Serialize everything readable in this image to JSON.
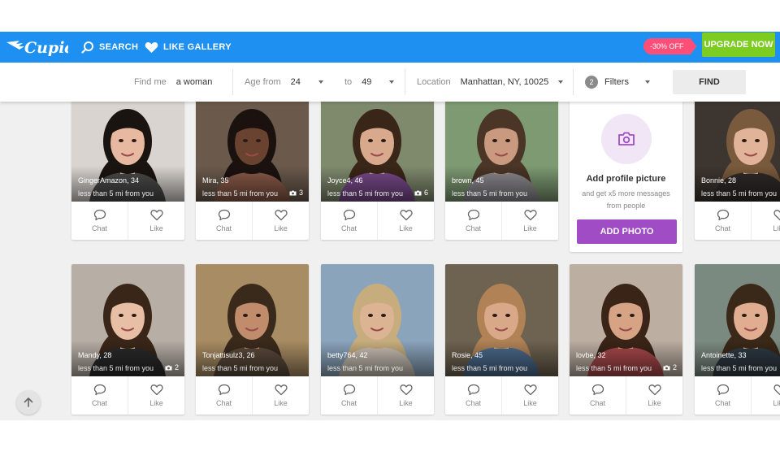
{
  "nav": {
    "logo_text": "Cupid",
    "search_label": "SEARCH",
    "gallery_label": "LIKE GALLERY",
    "discount_label": "-30% OFF",
    "upgrade_label": "UPGRADE NOW",
    "colors": {
      "bar": "#1e90f2",
      "upgrade": "#7ccc21",
      "discount": "#ff4f78"
    }
  },
  "filters": {
    "find_me_label": "Find me",
    "find_me_value": "a woman",
    "age_from_label": "Age from",
    "age_from_value": "24",
    "age_to_label": "to",
    "age_to_value": "49",
    "location_label": "Location",
    "location_value": "Manhattan, NY, 10025",
    "filters_count": "2",
    "filters_label": "Filters",
    "find_label": "FIND"
  },
  "add_photo": {
    "title": "Add profile picture",
    "subtitle": "and get x5 more messages from people",
    "button_label": "ADD PHOTO",
    "accent": "#a04cc4"
  },
  "actions": {
    "chat_label": "Chat",
    "like_label": "Like"
  },
  "profiles": [
    {
      "name": "GingerAmazon, 34",
      "distance": "less than 5 mi from you",
      "photos": "",
      "bg": "#d9d4cf",
      "hair": "#1a1410",
      "skin": "#e6b9a0",
      "shirt": "#4a4a4a"
    },
    {
      "name": "Mira, 35",
      "distance": "less than 5 mi from you",
      "photos": "3",
      "bg": "#6b5a4c",
      "hair": "#1b1210",
      "skin": "#6a4330",
      "shirt": "#8a5a48"
    },
    {
      "name": "Joyce4, 46",
      "distance": "less than 5 mi from you",
      "photos": "6",
      "bg": "#7f8a6d",
      "hair": "#3a2618",
      "skin": "#d9a98e",
      "shirt": "#7a4a8c"
    },
    {
      "name": "brown, 45",
      "distance": "less than 5 mi from you",
      "photos": "",
      "bg": "#7d9a72",
      "hair": "#4a3526",
      "skin": "#c99a80",
      "shirt": "#8c8a8e"
    },
    {
      "name": "Bonnie, 28",
      "distance": "less than 5 mi from you",
      "photos": "",
      "bg": "#3d3530",
      "hair": "#7a5a3c",
      "skin": "#e1b49a",
      "shirt": "#2f2a28"
    },
    {
      "name": "Mandy, 28",
      "distance": "less than 5 mi from you",
      "photos": "2",
      "bg": "#b7aea6",
      "hair": "#3a2618",
      "skin": "#e8bfa4",
      "shirt": "#2a2a2a"
    },
    {
      "name": "Tonjattisulz3, 26",
      "distance": "less than 5 mi from you",
      "photos": "",
      "bg": "#a88c63",
      "hair": "#3a2a1c",
      "skin": "#c08c6c",
      "shirt": "#5a4a3a"
    },
    {
      "name": "betty764, 42",
      "distance": "less than 5 mi from you",
      "photos": "",
      "bg": "#8aa4bc",
      "hair": "#c7ad7e",
      "skin": "#dcb494",
      "shirt": "#c9c0b4"
    },
    {
      "name": "Rosie, 45",
      "distance": "less than 5 mi from you",
      "photos": "",
      "bg": "#6e6250",
      "hair": "#b08256",
      "skin": "#d9a888",
      "shirt": "#4b6a8c"
    },
    {
      "name": "lovbe, 32",
      "distance": "less than 5 mi from you",
      "photos": "2",
      "bg": "#bcaea0",
      "hair": "#3a2418",
      "skin": "#d6a484",
      "shirt": "#a8484a"
    },
    {
      "name": "Antoinette, 33",
      "distance": "less than 5 mi from you",
      "photos": "",
      "bg": "#7a8a80",
      "hair": "#3a2818",
      "skin": "#e0ad90",
      "shirt": "#2e3a44"
    }
  ]
}
